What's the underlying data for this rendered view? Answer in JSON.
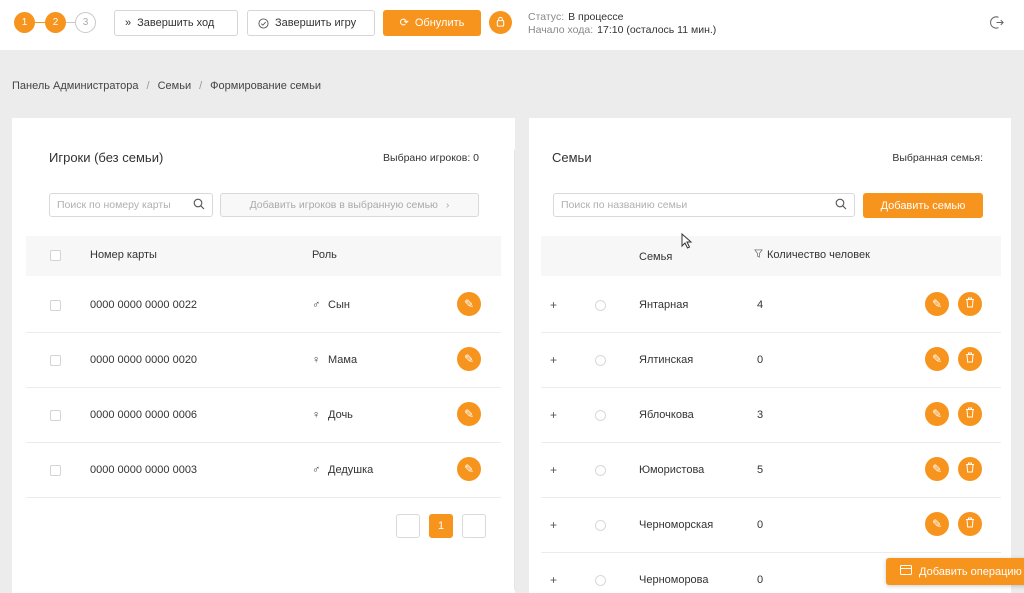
{
  "steps": [
    "1",
    "2",
    "3"
  ],
  "toolbar": {
    "end_turn": "Завершить ход",
    "end_game": "Завершить игру",
    "reset": "Обнулить"
  },
  "status": {
    "status_label": "Статус:",
    "status_value": "В процессе",
    "turn_label": "Начало хода:",
    "turn_value": "17:10 (осталось 11 мин.)"
  },
  "breadcrumb": [
    "Панель Администратора",
    "/",
    "Семьи",
    "/",
    "Формирование семьи"
  ],
  "players": {
    "title": "Игроки (без семьи)",
    "selected": "Выбрано игроков: 0",
    "search_placeholder": "Поиск по номеру карты",
    "add_button": "Добавить игроков в выбранную семью",
    "columns": [
      "Номер карты",
      "Роль"
    ],
    "rows": [
      {
        "card": "0000 0000 0000 0022",
        "role": "Сын",
        "gender": "♂"
      },
      {
        "card": "0000 0000 0000 0020",
        "role": "Мама",
        "gender": "♀"
      },
      {
        "card": "0000 0000 0000 0006",
        "role": "Дочь",
        "gender": "♀"
      },
      {
        "card": "0000 0000 0000 0003",
        "role": "Дедушка",
        "gender": "♂"
      }
    ],
    "page": "1"
  },
  "families": {
    "title": "Семьи",
    "selected": "Выбранная семья:",
    "search_placeholder": "Поиск по названию семьи",
    "add_button": "Добавить семью",
    "columns": [
      "Семья",
      "Количество человек"
    ],
    "rows": [
      {
        "name": "Янтарная",
        "count": "4"
      },
      {
        "name": "Ялтинская",
        "count": "0"
      },
      {
        "name": "Яблочкова",
        "count": "3"
      },
      {
        "name": "Юмористова",
        "count": "5"
      },
      {
        "name": "Черноморская",
        "count": "0"
      },
      {
        "name": "Черноморова",
        "count": "0"
      }
    ]
  },
  "float_button": "Добавить операцию",
  "colors": {
    "accent": "#f7941d",
    "background": "#ececec"
  }
}
